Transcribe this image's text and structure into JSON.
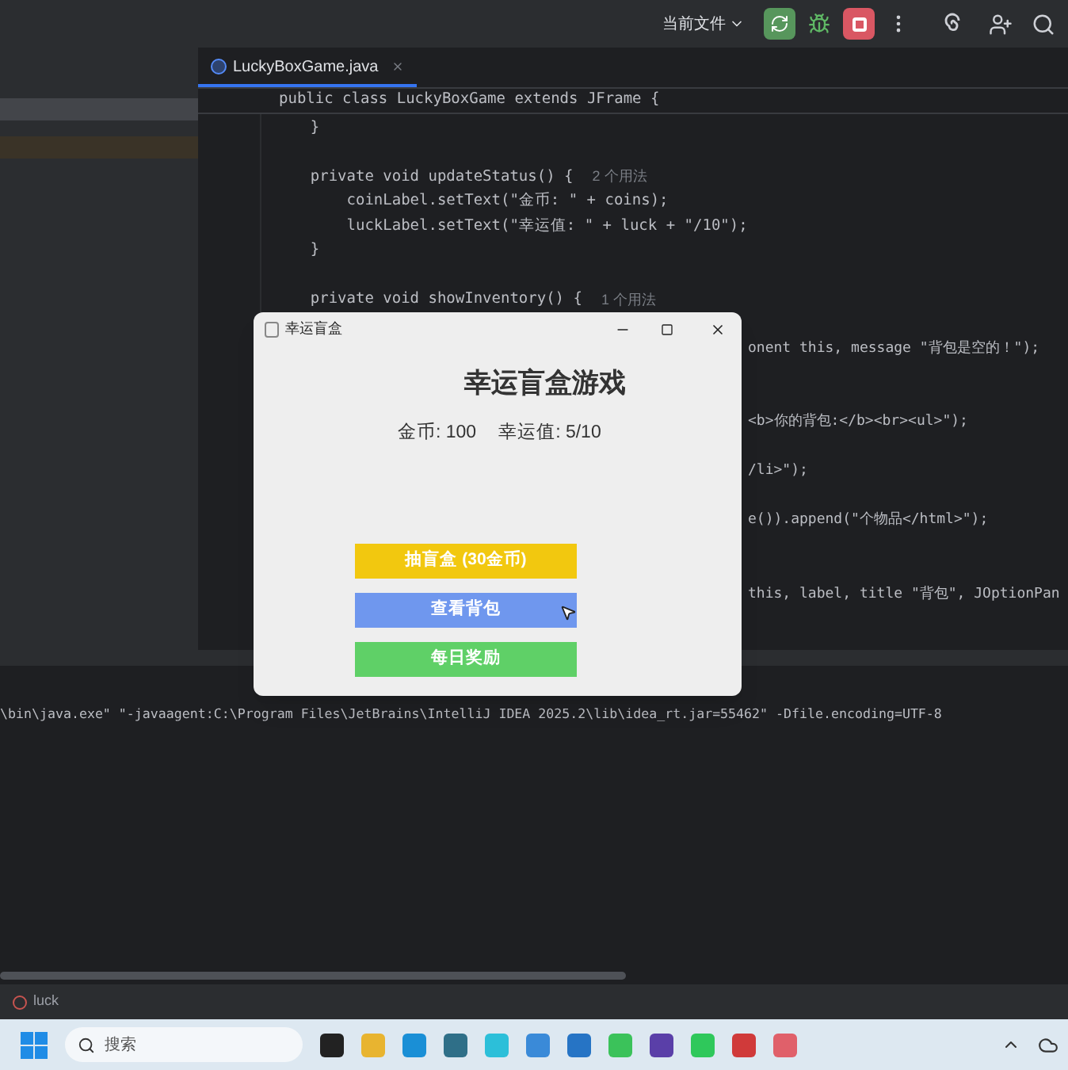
{
  "toolbar": {
    "run_config": "当前文件"
  },
  "editor": {
    "tabs": [
      {
        "label": "LuckyBoxGame.java",
        "selected": true
      }
    ],
    "sticky_line": "public class LuckyBoxGame extends JFrame {",
    "lines": [
      {
        "kind": "code",
        "text": "    }"
      },
      {
        "kind": "blank"
      },
      {
        "kind": "code",
        "text": "    private void updateStatus() {",
        "hint": "2 个用法"
      },
      {
        "kind": "code",
        "text": "        coinLabel.setText(\"金币: \" + coins);"
      },
      {
        "kind": "code",
        "text": "        luckLabel.setText(\"幸运值: \" + luck + \"/10\");"
      },
      {
        "kind": "code",
        "text": "    }"
      },
      {
        "kind": "blank"
      },
      {
        "kind": "code",
        "text": "    private void showInventory() {",
        "hint": "1 个用法"
      },
      {
        "kind": "blank"
      },
      {
        "kind": "clipped",
        "text": "onent this, message \"背包是空的！\");"
      },
      {
        "kind": "blank"
      },
      {
        "kind": "blank"
      },
      {
        "kind": "clipped",
        "text": "<b>你的背包:</b><br><ul>\");"
      },
      {
        "kind": "blank"
      },
      {
        "kind": "clipped",
        "text": "/li>\");"
      },
      {
        "kind": "blank"
      },
      {
        "kind": "clipped",
        "text": "e()).append(\"个物品</html>\");"
      },
      {
        "kind": "blank"
      },
      {
        "kind": "blank"
      },
      {
        "kind": "clipped",
        "text": "this, label, title \"背包\", JOptionPan"
      }
    ]
  },
  "console": {
    "command": "\\bin\\java.exe\" \"-javaagent:C:\\Program Files\\JetBrains\\IntelliJ IDEA 2025.2\\lib\\idea_rt.jar=55462\" -Dfile.encoding=UTF-8"
  },
  "status_bar": {
    "item": "luck"
  },
  "dialog": {
    "title": "幸运盲盒",
    "heading": "幸运盲盒游戏",
    "coins": "金币: 100",
    "luck": "幸运值: 5/10",
    "buttons": [
      {
        "label": "抽盲盒 (30金币)",
        "color": "#f2c80f"
      },
      {
        "label": "查看背包",
        "color": "#6f97ee"
      },
      {
        "label": "每日奖励",
        "color": "#5fd067"
      }
    ]
  },
  "taskbar": {
    "search_placeholder": "搜索"
  }
}
